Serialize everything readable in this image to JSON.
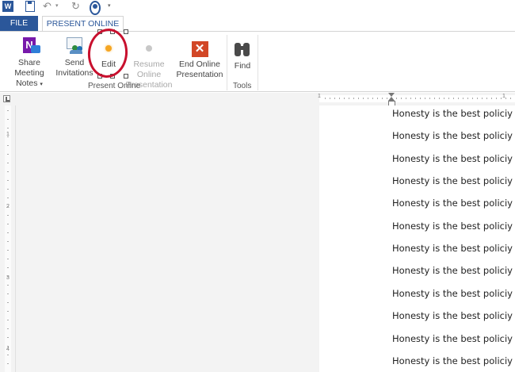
{
  "quick_access": {
    "app_icon": "word-icon",
    "app_letter": "W",
    "icons": [
      "save-icon",
      "undo-icon",
      "undo-dropdown-icon",
      "redo-icon",
      "present-online-icon",
      "customize-toolbar-icon"
    ]
  },
  "tabs": [
    {
      "label": "FILE",
      "active": false
    },
    {
      "label": "PRESENT ONLINE",
      "active": true
    }
  ],
  "ribbon": {
    "groups": [
      {
        "label": "Present Online",
        "buttons": [
          {
            "name": "share-meeting-notes",
            "line1": "Share Meeting",
            "line2": "Notes",
            "dropdown": "▾",
            "icon": "onenote-icon",
            "enabled": true
          },
          {
            "name": "send-invitations",
            "line1": "Send",
            "line2": "Invitations",
            "icon": "send-invitations-icon",
            "enabled": true
          },
          {
            "name": "edit",
            "line1": "Edit",
            "icon": "edit-dot-icon",
            "enabled": true,
            "highlighted": true
          },
          {
            "name": "resume-online-presentation",
            "line1": "Resume Online",
            "line2": "Presentation",
            "icon": "resume-dot-icon",
            "enabled": false
          },
          {
            "name": "end-online-presentation",
            "line1": "End Online",
            "line2": "Presentation",
            "icon": "end-x-icon",
            "icon_glyph": "✕",
            "enabled": true
          }
        ]
      },
      {
        "label": "Tools",
        "buttons": [
          {
            "name": "find",
            "line1": "Find",
            "icon": "binoculars-icon",
            "enabled": true
          }
        ]
      }
    ]
  },
  "rulers": {
    "horizontal_numbers": [
      "1",
      "1"
    ],
    "vertical_numbers": [
      "1",
      "2",
      "3",
      "4"
    ]
  },
  "document": {
    "lines": [
      "Honesty is the best policiy",
      "Honesty is the best policiy",
      "Honesty is the best policiy",
      "Honesty is the best policiy",
      "Honesty is the best policiy",
      "Honesty is the best policiy",
      "Honesty is the best policiy",
      "Honesty is the best policiy",
      "Honesty is the best policiy",
      "Honesty is the best policiy",
      "Honesty is the best policiy",
      "Honesty is the best policiy"
    ]
  },
  "colors": {
    "accent": "#2b579a",
    "highlight_ring": "#c8102e",
    "edit_dot": "#f5a623",
    "end_button": "#d24726"
  }
}
